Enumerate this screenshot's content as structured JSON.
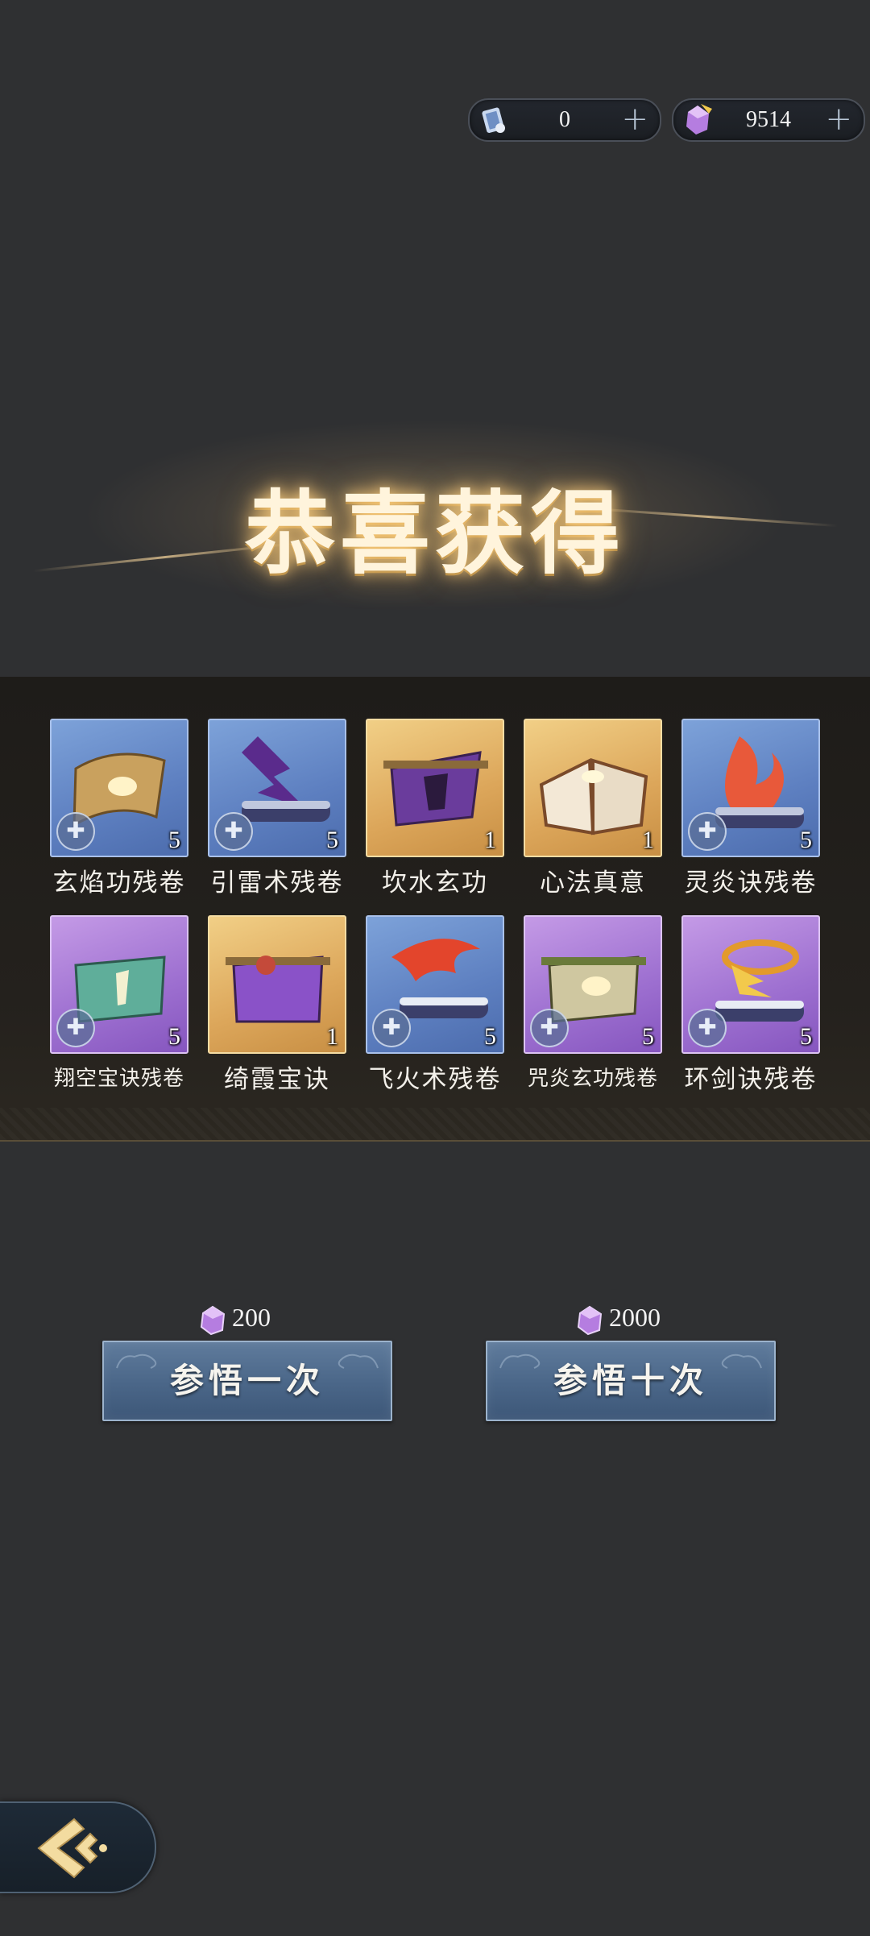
{
  "currencies": [
    {
      "icon": "scroll-ticket-icon",
      "value": "0",
      "plus": "+"
    },
    {
      "icon": "purple-crystal-icon",
      "value": "9514",
      "plus": "+"
    }
  ],
  "title": "恭喜获得",
  "rewards": [
    {
      "name": "玄焰功残卷",
      "count": "5",
      "rarity": "blue",
      "fragment": true
    },
    {
      "name": "引雷术残卷",
      "count": "5",
      "rarity": "blue",
      "fragment": true
    },
    {
      "name": "坎水玄功",
      "count": "1",
      "rarity": "gold",
      "fragment": false
    },
    {
      "name": "心法真意",
      "count": "1",
      "rarity": "gold",
      "fragment": false
    },
    {
      "name": "灵炎诀残卷",
      "count": "5",
      "rarity": "blue",
      "fragment": true
    },
    {
      "name": "翔空宝诀残卷",
      "count": "5",
      "rarity": "purple",
      "fragment": true
    },
    {
      "name": "绮霞宝诀",
      "count": "1",
      "rarity": "gold",
      "fragment": false
    },
    {
      "name": "飞火术残卷",
      "count": "5",
      "rarity": "blue",
      "fragment": true
    },
    {
      "name": "咒炎玄功残卷",
      "count": "5",
      "rarity": "purple",
      "fragment": true
    },
    {
      "name": "环剑诀残卷",
      "count": "5",
      "rarity": "purple",
      "fragment": true
    }
  ],
  "draw_once": {
    "cost": "200",
    "label": "参悟一次"
  },
  "draw_ten": {
    "cost": "2000",
    "label": "参悟十次"
  },
  "colors": {
    "blue": "#6a8fcf",
    "gold": "#e4b86b",
    "purple": "#a77bd6",
    "button": "#4f6b8d"
  }
}
